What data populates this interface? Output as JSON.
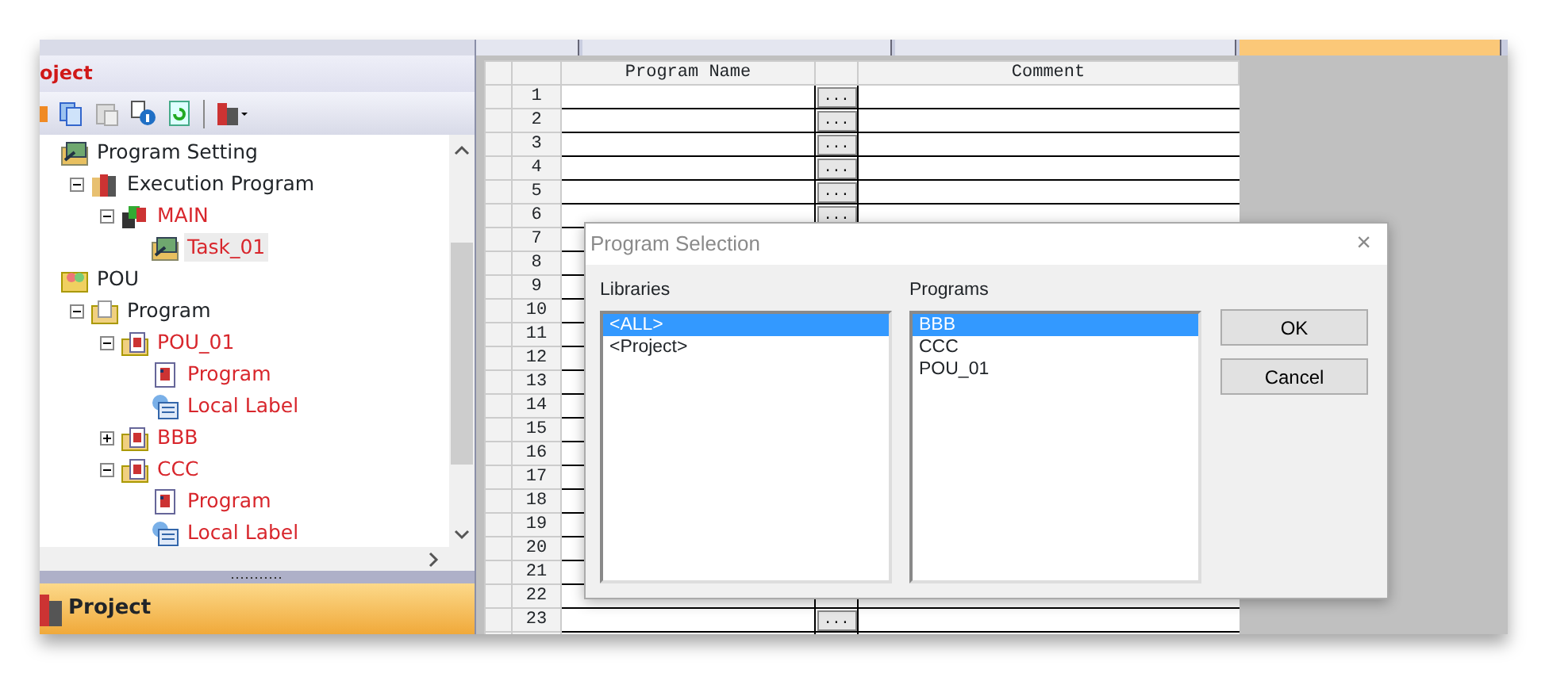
{
  "tabs": [
    {
      "selected": false
    },
    {
      "selected": false
    },
    {
      "selected": false
    },
    {
      "selected": true
    }
  ],
  "project_panel": {
    "header": "oject",
    "tree": [
      {
        "label": "Program Setting",
        "kind": "setting",
        "highlighted": false,
        "selected": false,
        "children": [
          {
            "label": "Execution Program",
            "kind": "execution",
            "expanded": true,
            "highlighted": false,
            "selected": false,
            "children": [
              {
                "label": "MAIN",
                "kind": "main",
                "expanded": true,
                "highlighted": true,
                "selected": false,
                "children": [
                  {
                    "label": "Task_01",
                    "kind": "setting",
                    "highlighted": true,
                    "selected": true
                  }
                ]
              }
            ]
          }
        ]
      },
      {
        "label": "POU",
        "kind": "pou",
        "highlighted": false,
        "selected": false,
        "children": [
          {
            "label": "Program",
            "kind": "folder",
            "expanded": true,
            "highlighted": false,
            "selected": false,
            "children": [
              {
                "label": "POU_01",
                "kind": "block",
                "expanded": true,
                "highlighted": true,
                "selected": false,
                "children": [
                  {
                    "label": "Program",
                    "kind": "doc",
                    "highlighted": true,
                    "selected": false
                  },
                  {
                    "label": "Local Label",
                    "kind": "label",
                    "highlighted": true,
                    "selected": false
                  }
                ]
              },
              {
                "label": "BBB",
                "kind": "block",
                "expanded": false,
                "highlighted": true,
                "selected": false
              },
              {
                "label": "CCC",
                "kind": "block",
                "expanded": true,
                "highlighted": true,
                "selected": false,
                "children": [
                  {
                    "label": "Program",
                    "kind": "doc",
                    "highlighted": true,
                    "selected": false
                  },
                  {
                    "label": "Local Label",
                    "kind": "label",
                    "highlighted": true,
                    "selected": false
                  }
                ]
              }
            ]
          }
        ]
      }
    ],
    "footer": "Project"
  },
  "grid": {
    "columns": [
      "Program Name",
      "Comment"
    ],
    "rows": [
      {
        "number": "1",
        "button": "..."
      },
      {
        "number": "2",
        "button": "..."
      },
      {
        "number": "3",
        "button": "..."
      },
      {
        "number": "4",
        "button": "..."
      },
      {
        "number": "5",
        "button": "..."
      },
      {
        "number": "6",
        "button": "..."
      },
      {
        "number": "7"
      },
      {
        "number": "8"
      },
      {
        "number": "9"
      },
      {
        "number": "10"
      },
      {
        "number": "11"
      },
      {
        "number": "12"
      },
      {
        "number": "13"
      },
      {
        "number": "14"
      },
      {
        "number": "15"
      },
      {
        "number": "16"
      },
      {
        "number": "17"
      },
      {
        "number": "18"
      },
      {
        "number": "19"
      },
      {
        "number": "20"
      },
      {
        "number": "21"
      },
      {
        "number": "22"
      },
      {
        "number": "23",
        "button": "..."
      }
    ]
  },
  "dialog": {
    "title": "Program Selection",
    "close": "×",
    "libraries": {
      "label": "Libraries",
      "items": [
        {
          "text": "<ALL>",
          "selected": true
        },
        {
          "text": "<Project>",
          "selected": false
        }
      ]
    },
    "programs": {
      "label": "Programs",
      "items": [
        {
          "text": "BBB",
          "selected": true
        },
        {
          "text": "CCC",
          "selected": false
        },
        {
          "text": "POU_01",
          "selected": false
        }
      ]
    },
    "buttons": [
      "OK",
      "Cancel"
    ]
  }
}
